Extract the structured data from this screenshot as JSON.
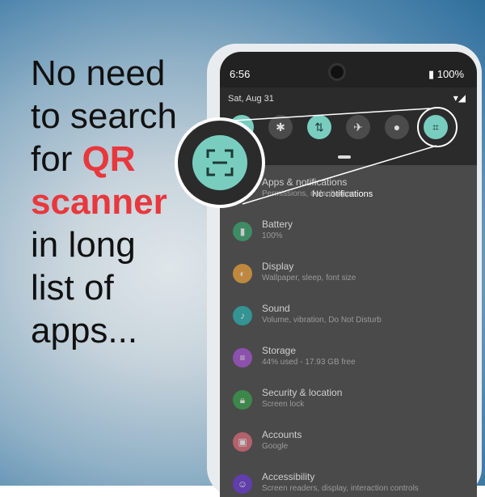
{
  "headline": {
    "line1": "No need",
    "line2": "to search",
    "line3a": "for ",
    "line3b": "QR",
    "line4": "scanner",
    "line5": "in long",
    "line6": "list of",
    "line7": "apps..."
  },
  "statusbar": {
    "time": "6:56",
    "battery": "100%"
  },
  "quick_settings": {
    "date": "Sat, Aug 31",
    "tiles": [
      {
        "name": "wifi-icon",
        "on": true
      },
      {
        "name": "bluetooth-icon",
        "on": false
      },
      {
        "name": "data-icon",
        "on": true
      },
      {
        "name": "airplane-icon",
        "on": false
      },
      {
        "name": "location-icon",
        "on": false
      },
      {
        "name": "qr-scanner-icon",
        "on": true
      }
    ]
  },
  "notifications": {
    "empty_text": "No notifications"
  },
  "settings": [
    {
      "title": "Apps & notifications",
      "sub": "Permissions, default apps",
      "color": "#7aa7e0"
    },
    {
      "title": "Battery",
      "sub": "100%",
      "color": "#3aa870"
    },
    {
      "title": "Display",
      "sub": "Wallpaper, sleep, font size",
      "color": "#f2a33a"
    },
    {
      "title": "Sound",
      "sub": "Volume, vibration, Do Not Disturb",
      "color": "#2bb3b3"
    },
    {
      "title": "Storage",
      "sub": "44% used - 17.93 GB free",
      "color": "#a855d6"
    },
    {
      "title": "Security & location",
      "sub": "Screen lock",
      "color": "#38a14a"
    },
    {
      "title": "Accounts",
      "sub": "Google",
      "color": "#e06b7a"
    },
    {
      "title": "Accessibility",
      "sub": "Screen readers, display, interaction controls",
      "color": "#6a3ad6"
    }
  ],
  "colors": {
    "accent": "#e8373d",
    "tile_on": "#79cdbf"
  }
}
